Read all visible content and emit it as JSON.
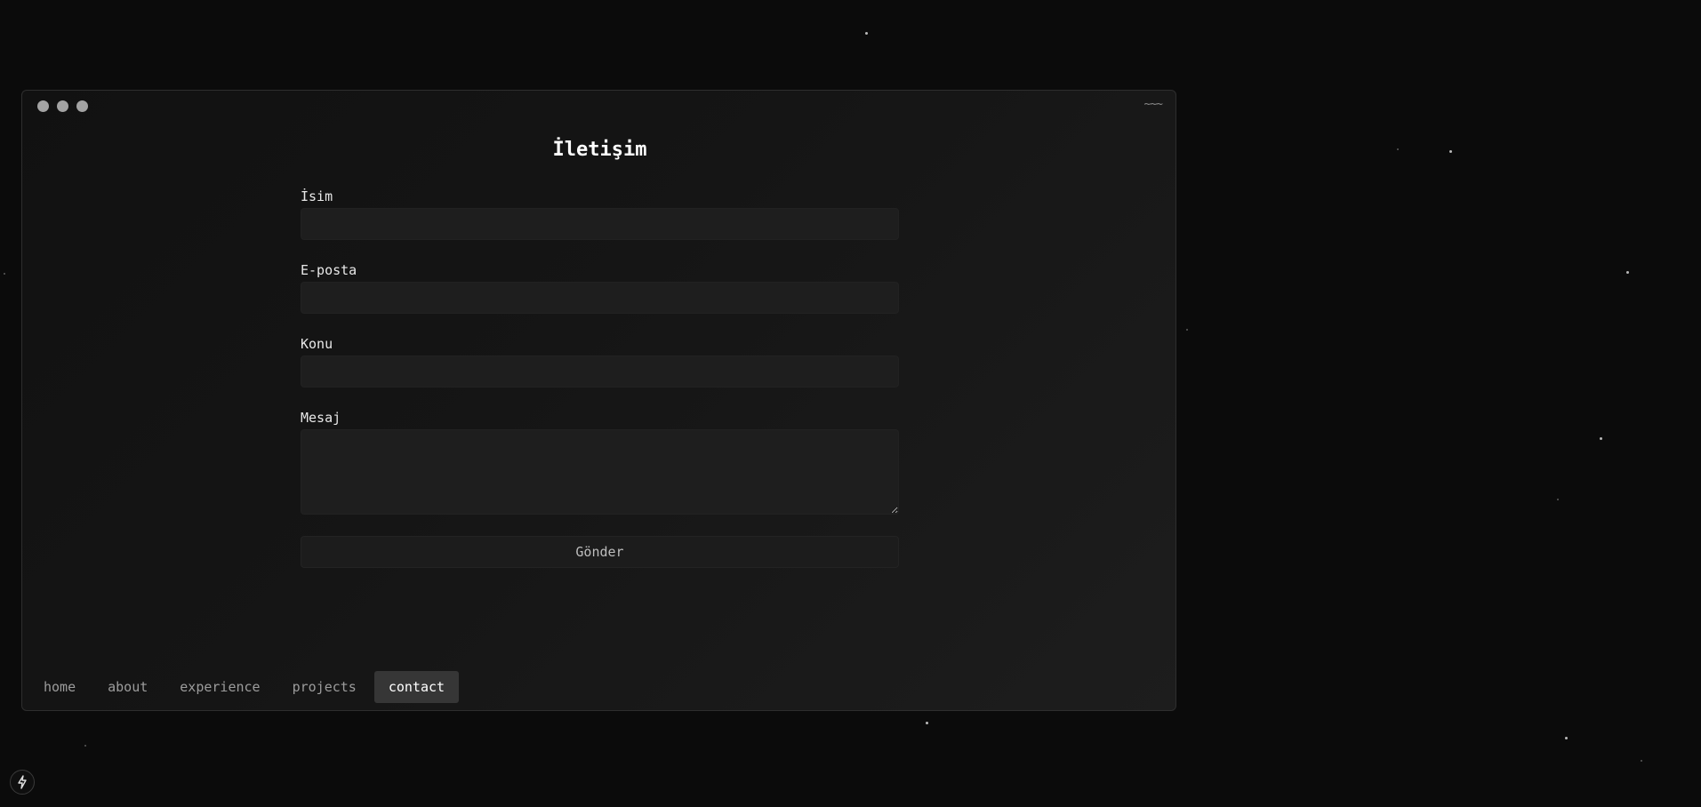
{
  "window": {
    "title_right": "~~~"
  },
  "page": {
    "heading": "İletişim"
  },
  "form": {
    "name_label": "İsim",
    "name_value": "",
    "email_label": "E-posta",
    "email_value": "",
    "subject_label": "Konu",
    "subject_value": "",
    "message_label": "Mesaj",
    "message_value": "",
    "submit_label": "Gönder"
  },
  "nav": {
    "items": [
      {
        "label": "home"
      },
      {
        "label": "about"
      },
      {
        "label": "experience"
      },
      {
        "label": "projects"
      },
      {
        "label": "contact",
        "active": true
      }
    ]
  },
  "icons": {
    "dev_indicator": "lightning-bolt-icon"
  },
  "colors": {
    "background": "#0b0b0b",
    "window": "#151515",
    "input": "#1e1e1e",
    "active_tab": "#363636"
  }
}
